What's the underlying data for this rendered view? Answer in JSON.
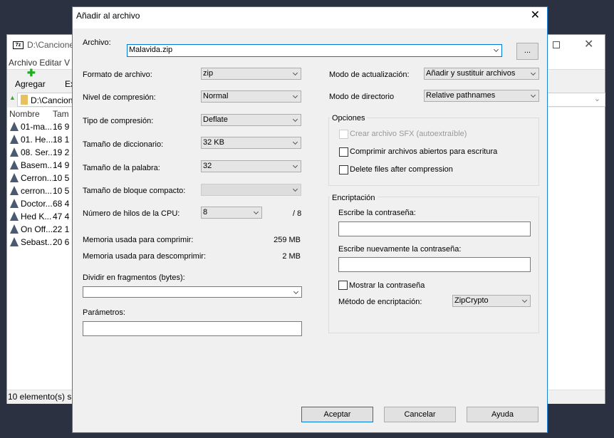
{
  "background_window": {
    "title": "D:\\Canciones",
    "menu": [
      "Archivo",
      "Editar",
      "V"
    ],
    "toolbar": {
      "add_label": "Agregar",
      "extract_label": "Ex"
    },
    "address": "D:\\Cancion",
    "columns": [
      "Nombre",
      "Tam"
    ],
    "files": [
      {
        "name": "01-ma...",
        "size": "16 9"
      },
      {
        "name": "01. He...",
        "size": "18 1"
      },
      {
        "name": "08. Ser...",
        "size": "19 2"
      },
      {
        "name": "Basem...",
        "size": "14 9"
      },
      {
        "name": "Cerron...",
        "size": "10 5"
      },
      {
        "name": "cerron...",
        "size": "10 5"
      },
      {
        "name": "Doctor...",
        "size": "68 4"
      },
      {
        "name": "Hed K...",
        "size": "47 4"
      },
      {
        "name": "On Off...",
        "size": "22 1"
      },
      {
        "name": "Sebast...",
        "size": "20 6"
      }
    ],
    "status": "10 elemento(s) s"
  },
  "dialog": {
    "title": "Añadir al archivo",
    "archive_label": "Archivo:",
    "archive_value": "Malavida.zip",
    "browse_label": "...",
    "format_label": "Formato de archivo:",
    "format_value": "zip",
    "level_label": "Nivel de compresión:",
    "level_value": "Normal",
    "method_label": "Tipo de compresión:",
    "method_value": "Deflate",
    "dict_label": "Tamaño de diccionario:",
    "dict_value": "32 KB",
    "word_label": "Tamaño de la palabra:",
    "word_value": "32",
    "solid_label": "Tamaño de bloque compacto:",
    "solid_value": "",
    "threads_label": "Número de hilos de la CPU:",
    "threads_value": "8",
    "threads_max": "/ 8",
    "mem_comp_label": "Memoria usada para comprimir:",
    "mem_comp_value": "259 MB",
    "mem_decomp_label": "Memoria usada para descomprimir:",
    "mem_decomp_value": "2 MB",
    "split_label": "Dividir en fragmentos (bytes):",
    "split_value": "",
    "params_label": "Parámetros:",
    "params_value": "",
    "update_label": "Modo de actualización:",
    "update_value": "Añadir y sustituir archivos",
    "path_label": "Modo de directorio",
    "path_value": "Relative pathnames",
    "options": {
      "title": "Opciones",
      "sfx": "Crear archivo SFX (autoextraíble)",
      "open_files": "Comprimir archivos abiertos para escritura",
      "delete": "Delete files after compression"
    },
    "encryption": {
      "title": "Encriptación",
      "pw_label": "Escribe la contraseña:",
      "pw2_label": "Escribe nuevamente la contraseña:",
      "show_label": "Mostrar la contraseña",
      "method_label": "Método de encriptación:",
      "method_value": "ZipCrypto"
    },
    "buttons": {
      "ok": "Aceptar",
      "cancel": "Cancelar",
      "help": "Ayuda"
    }
  }
}
